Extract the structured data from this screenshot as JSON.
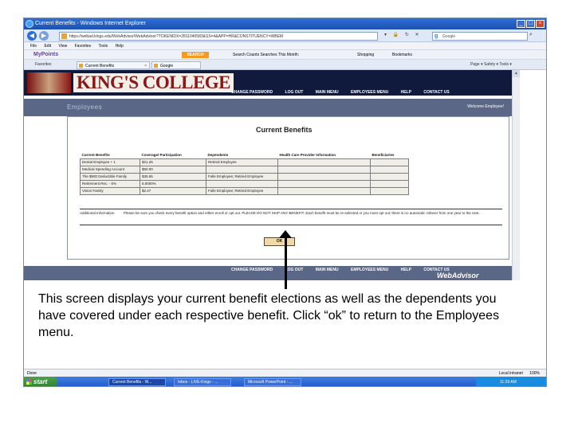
{
  "window": {
    "title": "Current Benefits - Windows Internet Explorer",
    "buttons": [
      "_",
      "□",
      "×"
    ]
  },
  "address": {
    "url": "https://webad.kings.edu/WebAdvisor/WebAdvisor?TOKENIDX=2811040583&SS=4&APP=HR&CONSTITUENCY=WBEM",
    "search_placeholder": "Google"
  },
  "menu": {
    "items": [
      "File",
      "Edit",
      "View",
      "Favorites",
      "Tools",
      "Help"
    ]
  },
  "toolbar": {
    "brand": "MyPoints",
    "search_button": "SEARCH",
    "search_counter": "Search Counts  Searches This Month:",
    "shopping": "Shopping",
    "bookmarks": "Bookmarks"
  },
  "tabs": {
    "favorites": "Favorites",
    "tab1": "Current Benefits",
    "tab2": "Google",
    "commands": "Page ▾   Safety ▾   Tools ▾"
  },
  "site": {
    "logo": "KING'S COLLEGE",
    "nav": [
      "CHANGE PASSWORD",
      "LOG OUT",
      "MAIN MENU",
      "EMPLOYEES MENU",
      "HELP",
      "CONTACT US"
    ],
    "section": "Employees",
    "welcome": "Welcome Employee!",
    "page_title": "Current Benefits",
    "table": {
      "headers": [
        "Current Benefits",
        "Coverage/ Participation",
        "Dependents",
        "Health Care Provider Information",
        "Beneficiaries"
      ],
      "rows": [
        [
          "Dental Employee + 1",
          "$21.25",
          "Retired Employee",
          "",
          ""
        ],
        [
          "Medical Spending Account",
          "$50.00",
          "",
          "",
          ""
        ],
        [
          "The $500 Deductible Family",
          "$35.55",
          "Fulle Employee; Retired Employee",
          "",
          ""
        ],
        [
          "Retirement Rec. - 5%",
          "5.0000%",
          "",
          "",
          ""
        ],
        [
          "Vision Family",
          "$2.47",
          "Fulle Employee; Retired Employee",
          "",
          ""
        ]
      ]
    },
    "additional_label": "Additional Information",
    "notice": "Please be sure you check every benefit option and either enroll or opt out. PLEASE DO NOT SKIP ANY BENEFIT. Each benefit must be re-selected or you must opt out; there is no automatic rollover from one year to the next.",
    "ok_label": "OK",
    "webadvisor": "WebAdvisor"
  },
  "caption": "This screen displays your current benefit elections as well as the dependents you have covered under each respective benefit.  Click “ok” to return to the Employees menu.",
  "status": {
    "left": "Done",
    "zone": "Local intranet",
    "zoom": "100%"
  },
  "taskbar": {
    "start": "start",
    "tasks": [
      "Current Benefits - W...",
      "Inbox - LIVE-Kings - ...",
      "Microsoft PowerPoint - ..."
    ],
    "clock": "11:29 AM"
  }
}
